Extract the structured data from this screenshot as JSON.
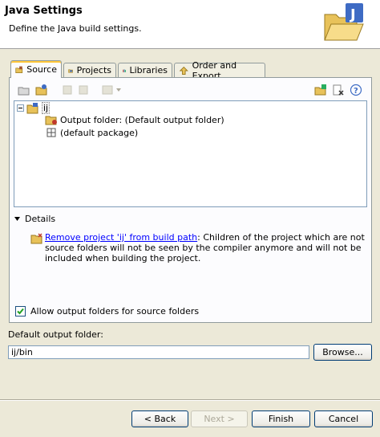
{
  "header": {
    "title": "Java Settings",
    "subtitle": "Define the Java build settings.",
    "icon": "java-folder-icon"
  },
  "tabs": [
    {
      "label": "Source",
      "icon": "source-folder-icon",
      "active": true
    },
    {
      "label": "Projects",
      "icon": "projects-icon",
      "active": false
    },
    {
      "label": "Libraries",
      "icon": "libraries-icon",
      "active": false
    },
    {
      "label": "Order and Export",
      "icon": "order-export-icon",
      "active": false
    }
  ],
  "tree": {
    "root": "ij",
    "children": [
      {
        "label": "Output folder: (Default output folder)",
        "icon": "output-folder-icon"
      },
      {
        "label": "(default package)",
        "icon": "package-icon"
      }
    ]
  },
  "details": {
    "label": "Details",
    "link": "Remove project 'ij' from build path",
    "text": ": Children of the project which are not source folders will not be seen by the compiler anymore and will not be included when building the project."
  },
  "allow_output": {
    "label": "Allow output folders for source folders",
    "checked": true
  },
  "output_folder": {
    "label": "Default output folder:",
    "value": "ij/bin",
    "browse": "Browse..."
  },
  "buttons": {
    "back": "< Back",
    "next": "Next >",
    "finish": "Finish",
    "cancel": "Cancel"
  }
}
